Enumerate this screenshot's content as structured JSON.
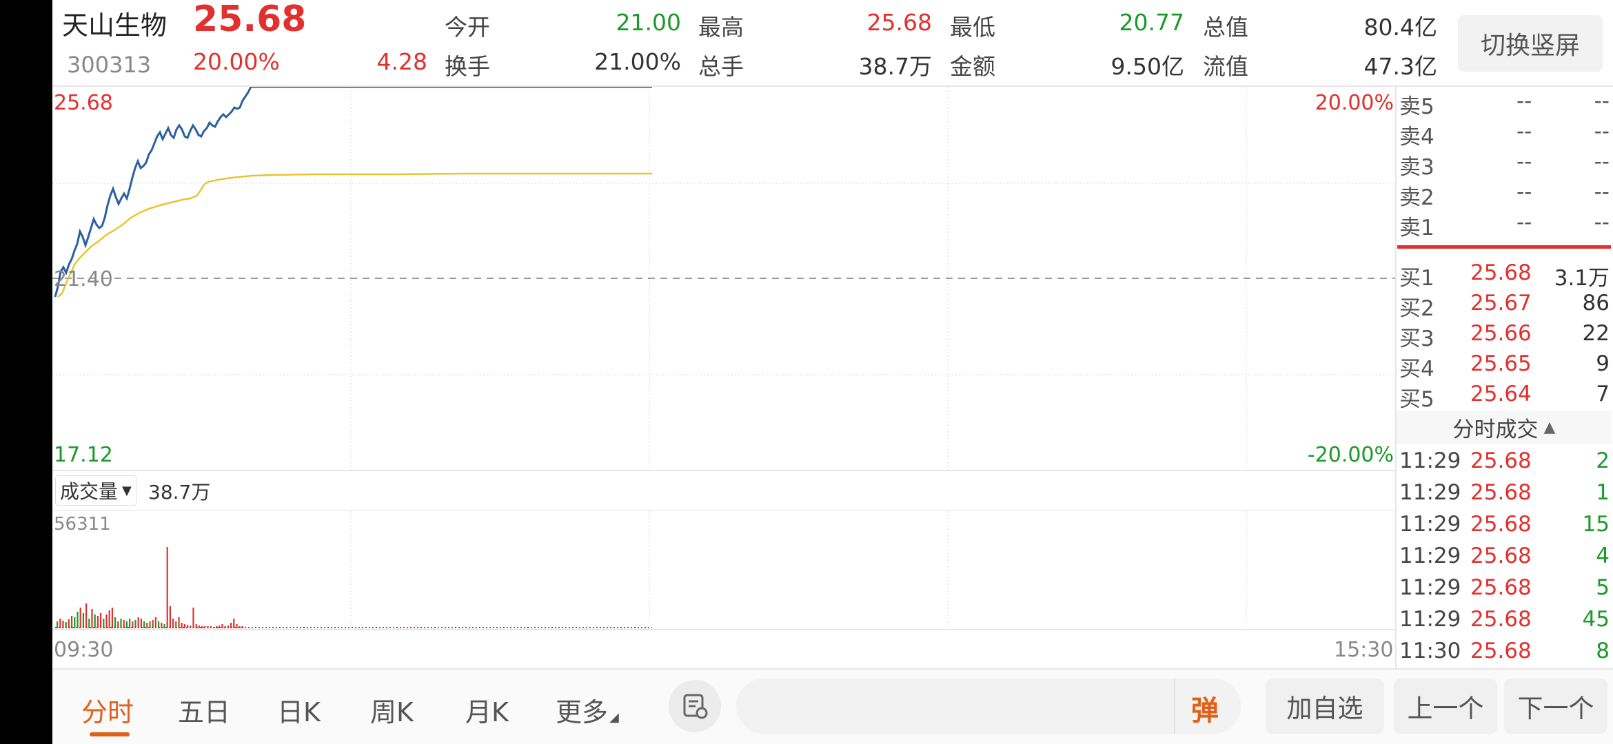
{
  "stock": {
    "name": "天山生物",
    "code": "300313",
    "price": "25.68",
    "change_pct": "20.00%",
    "change": "4.28"
  },
  "stats": {
    "open_label": "今开",
    "open": "21.00",
    "high_label": "最高",
    "high": "25.68",
    "low_label": "最低",
    "low": "20.77",
    "total_cap_label": "总值",
    "total_cap": "80.4亿",
    "turnover_label": "换手",
    "turnover": "21.00%",
    "volume_label": "总手",
    "volume": "38.7万",
    "amount_label": "金额",
    "amount": "9.50亿",
    "float_cap_label": "流值",
    "float_cap": "47.3亿"
  },
  "switch_button": "切换竖屏",
  "chart": {
    "price_max": "25.68",
    "price_mid": "21.40",
    "price_min": "17.12",
    "pct_max": "20.00%",
    "pct_min": "-20.00%",
    "volume_selector": "成交量",
    "volume_total": "38.7万",
    "volume_max": "56311",
    "time_start": "09:30",
    "time_end": "15:30"
  },
  "orderbook": {
    "asks": [
      {
        "label": "卖5",
        "price": "--",
        "vol": "--"
      },
      {
        "label": "卖4",
        "price": "--",
        "vol": "--"
      },
      {
        "label": "卖3",
        "price": "--",
        "vol": "--"
      },
      {
        "label": "卖2",
        "price": "--",
        "vol": "--"
      },
      {
        "label": "卖1",
        "price": "--",
        "vol": "--"
      }
    ],
    "bids": [
      {
        "label": "买1",
        "price": "25.68",
        "vol": "3.1万"
      },
      {
        "label": "买2",
        "price": "25.67",
        "vol": "86"
      },
      {
        "label": "买3",
        "price": "25.66",
        "vol": "22"
      },
      {
        "label": "买4",
        "price": "25.65",
        "vol": "9"
      },
      {
        "label": "买5",
        "price": "25.64",
        "vol": "7"
      }
    ]
  },
  "ticks": {
    "title": "分时成交",
    "rows": [
      {
        "time": "11:29",
        "price": "25.68",
        "vol": "2"
      },
      {
        "time": "11:29",
        "price": "25.68",
        "vol": "1"
      },
      {
        "time": "11:29",
        "price": "25.68",
        "vol": "15"
      },
      {
        "time": "11:29",
        "price": "25.68",
        "vol": "4"
      },
      {
        "time": "11:29",
        "price": "25.68",
        "vol": "5"
      },
      {
        "time": "11:29",
        "price": "25.68",
        "vol": "45"
      },
      {
        "time": "11:30",
        "price": "25.68",
        "vol": "8"
      }
    ]
  },
  "tabs": {
    "t1": "分时",
    "t2": "五日",
    "t3": "日K",
    "t4": "周K",
    "t5": "月K",
    "t6": "更多"
  },
  "actions": {
    "danmu": "弹",
    "add_watch": "加自选",
    "prev": "上一个",
    "next": "下一个"
  },
  "colors": {
    "up": "#e0312f",
    "down": "#1a9a2a",
    "price_line": "#2a5fa0",
    "avg_line": "#e8c530",
    "accent": "#e0601a"
  }
}
